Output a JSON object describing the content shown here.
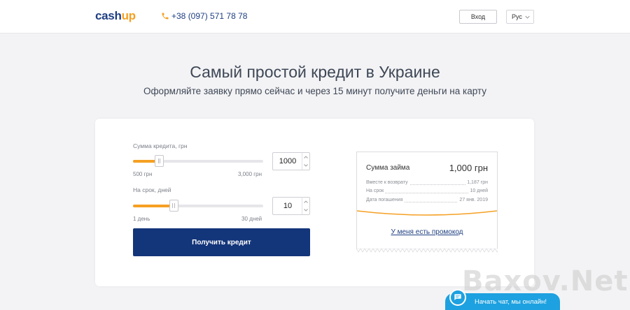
{
  "header": {
    "logo_part1": "cash",
    "logo_part2": "up",
    "phone": "+38 (097) 571 78 78",
    "login_label": "Вход",
    "language": "Рус"
  },
  "hero": {
    "title": "Самый простой кредит в Украине",
    "subtitle": "Оформляйте заявку прямо сейчас и через 15 минут получите деньги на карту"
  },
  "calculator": {
    "amount": {
      "label": "Сумма кредита, грн",
      "min_label": "500 грн",
      "max_label": "3,000 грн",
      "value": "1000",
      "fraction": 0.2
    },
    "term": {
      "label": "На срок, дней",
      "min_label": "1 день",
      "max_label": "30 дней",
      "value": "10",
      "fraction": 0.31
    },
    "submit_label": "Получить кредит"
  },
  "summary": {
    "title": "Сумма займа",
    "total": "1,000 грн",
    "rows": [
      {
        "label": "Вместе к возврату",
        "value": "1,187 грн"
      },
      {
        "label": "На срок",
        "value": "10 дней"
      },
      {
        "label": "Дата погашения",
        "value": "27 янв. 2019"
      }
    ],
    "promo_link": "У меня есть промокод"
  },
  "watermark": "Baxov.Net",
  "chat": {
    "label": "Начать чат, мы онлайн!"
  },
  "colors": {
    "accent": "#f5a023",
    "brand": "#13357a",
    "chat": "#1da1e0"
  }
}
